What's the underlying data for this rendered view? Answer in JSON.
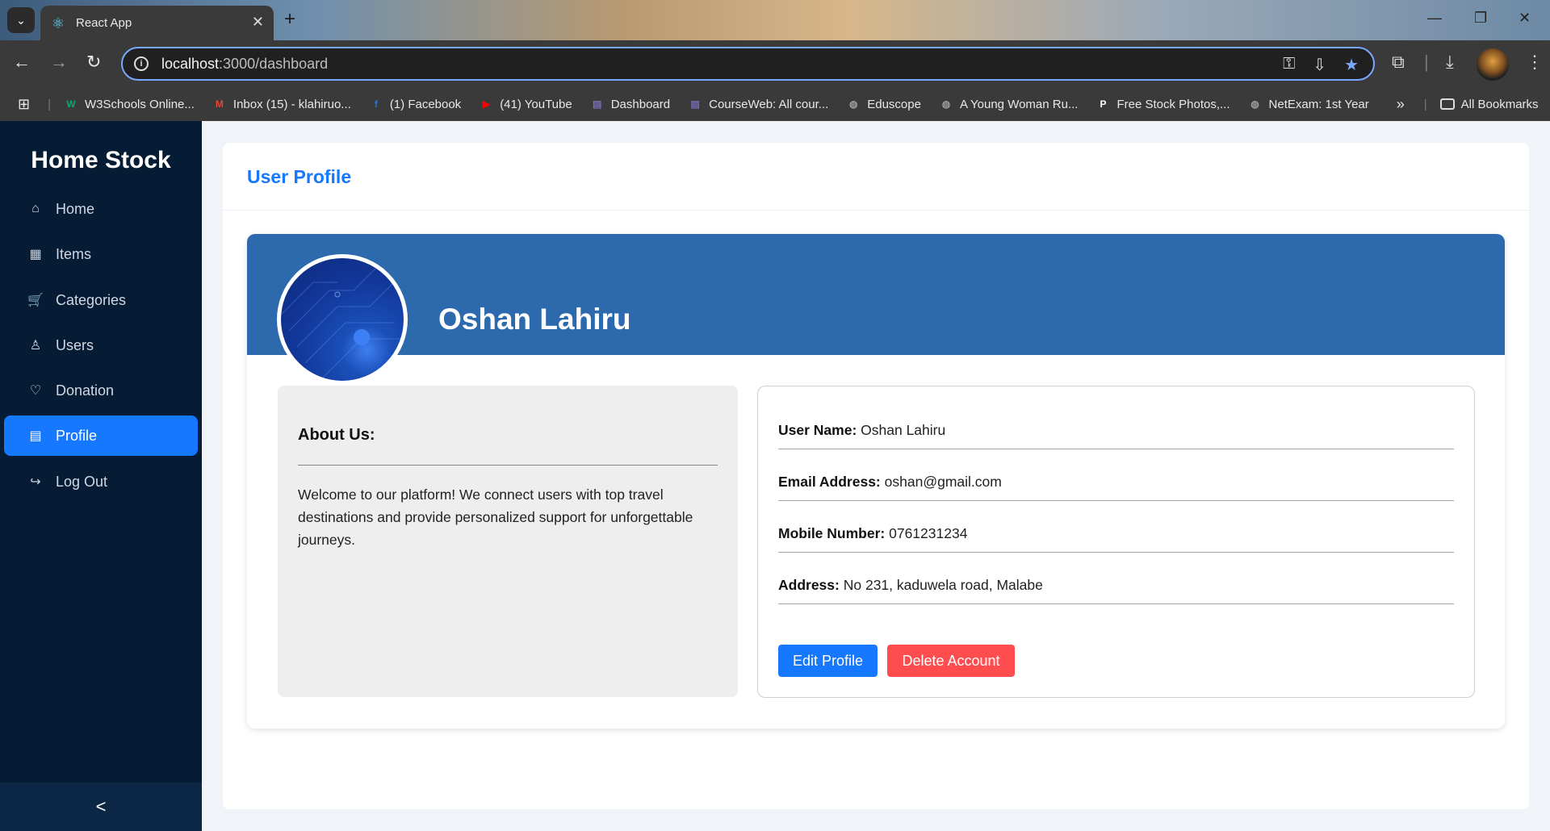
{
  "browser": {
    "tab_title": "React App",
    "url_host": "localhost",
    "url_path": ":3000/dashboard",
    "bookmarks": [
      {
        "label": "W3Schools Online...",
        "icon": "w3schools-icon",
        "color": "#04aa6d",
        "glyph": "W"
      },
      {
        "label": "Inbox (15) - klahiruo...",
        "icon": "gmail-icon",
        "color": "#ea4335",
        "glyph": "M"
      },
      {
        "label": "(1) Facebook",
        "icon": "facebook-icon",
        "color": "#1877f2",
        "glyph": "f"
      },
      {
        "label": "(41) YouTube",
        "icon": "youtube-icon",
        "color": "#ff0000",
        "glyph": "▶"
      },
      {
        "label": "Dashboard",
        "icon": "moodle-icon",
        "color": "#7a6ab8",
        "glyph": "▤"
      },
      {
        "label": "CourseWeb: All cour...",
        "icon": "moodle-icon",
        "color": "#7a6ab8",
        "glyph": "▤"
      },
      {
        "label": "Eduscope",
        "icon": "globe-icon",
        "color": "#9e9e9e",
        "glyph": "◍"
      },
      {
        "label": "A Young Woman Ru...",
        "icon": "globe-icon",
        "color": "#9e9e9e",
        "glyph": "◍"
      },
      {
        "label": "Free Stock Photos,...",
        "icon": "pexels-icon",
        "color": "#ffffff",
        "glyph": "P"
      },
      {
        "label": "NetExam: 1st Year",
        "icon": "globe-icon",
        "color": "#9e9e9e",
        "glyph": "◍"
      }
    ],
    "overflow_label": "»",
    "all_bookmarks_label": "All Bookmarks"
  },
  "sidebar": {
    "brand": "Home Stock",
    "items": [
      {
        "label": "Home",
        "icon": "home-icon",
        "glyph": "⌂"
      },
      {
        "label": "Items",
        "icon": "grid-icon",
        "glyph": "▦"
      },
      {
        "label": "Categories",
        "icon": "cart-icon",
        "glyph": "🛒"
      },
      {
        "label": "Users",
        "icon": "user-icon",
        "glyph": "♙"
      },
      {
        "label": "Donation",
        "icon": "heart-icon",
        "glyph": "♡"
      },
      {
        "label": "Profile",
        "icon": "profile-icon",
        "glyph": "▤"
      },
      {
        "label": "Log Out",
        "icon": "logout-icon",
        "glyph": "↪"
      }
    ],
    "active_item": "Profile",
    "collapse_glyph": "<"
  },
  "page": {
    "title": "User Profile",
    "profile": {
      "name": "Oshan Lahiru",
      "about_title": "About Us:",
      "about_text": "Welcome to our platform! We connect users with top travel destinations and provide personalized support for unforgettable journeys.",
      "fields": [
        {
          "label": "User Name:",
          "value": "Oshan Lahiru"
        },
        {
          "label": "Email Address:",
          "value": "oshan@gmail.com"
        },
        {
          "label": "Mobile Number:",
          "value": "0761231234"
        },
        {
          "label": "Address:",
          "value": "No 231, kaduwela road, Malabe"
        }
      ],
      "edit_label": "Edit Profile",
      "delete_label": "Delete Account"
    }
  },
  "colors": {
    "accent": "#1677ff",
    "danger": "#ff4d4f",
    "sidebar_bg": "#061b34",
    "banner": "#2d69ad"
  }
}
